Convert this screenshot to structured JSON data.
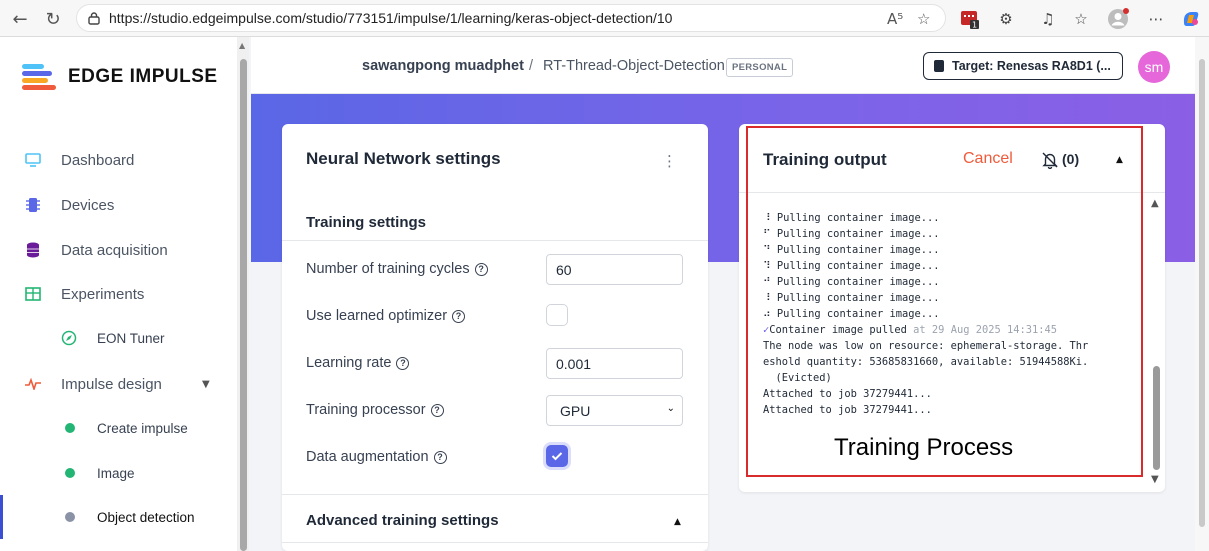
{
  "browser": {
    "url": "https://studio.edgeimpulse.com/studio/773151/impulse/1/learning/keras-object-detection/10",
    "badge_count": "1"
  },
  "sidebar": {
    "logo_text": "EDGE IMPULSE",
    "items": [
      {
        "label": "Dashboard",
        "icon": "monitor-icon"
      },
      {
        "label": "Devices",
        "icon": "chip-icon"
      },
      {
        "label": "Data acquisition",
        "icon": "database-icon"
      },
      {
        "label": "Experiments",
        "icon": "table-icon"
      },
      {
        "label": "EON Tuner",
        "icon": "compass-icon"
      },
      {
        "label": "Impulse design",
        "icon": "pulse-icon"
      },
      {
        "label": "Create impulse",
        "icon": "dot-icon"
      },
      {
        "label": "Image",
        "icon": "dot-icon"
      },
      {
        "label": "Object detection",
        "icon": "dot-icon"
      }
    ]
  },
  "header": {
    "user": "sawangpong muadphet",
    "separator": "/",
    "project": "RT-Thread-Object-Detection",
    "badge": "PERSONAL",
    "target": "Target: Renesas RA8D1 (...",
    "avatar": "sm"
  },
  "nn_settings": {
    "title": "Neural Network settings",
    "training_section": "Training settings",
    "fields": {
      "cycles_label": "Number of training cycles",
      "cycles_value": "60",
      "optimizer_label": "Use learned optimizer",
      "optimizer_checked": false,
      "lr_label": "Learning rate",
      "lr_value": "0.001",
      "processor_label": "Training processor",
      "processor_value": "GPU",
      "augment_label": "Data augmentation",
      "augment_checked": true
    },
    "advanced_section": "Advanced training settings"
  },
  "training_output": {
    "title": "Training output",
    "cancel": "Cancel",
    "notifications": "(0)",
    "log": [
      {
        "prefix": "⠸",
        "text": " Pulling container image..."
      },
      {
        "prefix": "⠋",
        "text": " Pulling container image..."
      },
      {
        "prefix": "⠙",
        "text": " Pulling container image..."
      },
      {
        "prefix": "⠹",
        "text": " Pulling container image..."
      },
      {
        "prefix": "⠚",
        "text": " Pulling container image..."
      },
      {
        "prefix": "⠸",
        "text": " Pulling container image..."
      },
      {
        "prefix": "⠴",
        "text": " Pulling container image..."
      }
    ],
    "pulled_text": "Container image pulled",
    "pulled_ts": " at 29 Aug 2025 14:31:45",
    "evict_line1": "The node was low on resource: ephemeral-storage. Thr",
    "evict_line2": "eshold quantity: 53685831660, available: 51944588Ki.",
    "evict_line3": "  (Evicted)",
    "attached1": "Attached to job 37279441...",
    "attached2": "Attached to job 37279441..."
  },
  "annotation": "Training Process",
  "colors": {
    "accent": "#5a67e6",
    "cancel": "#ef5b3b",
    "highlight_box": "#d92b2b",
    "avatar": "#e567d9"
  }
}
